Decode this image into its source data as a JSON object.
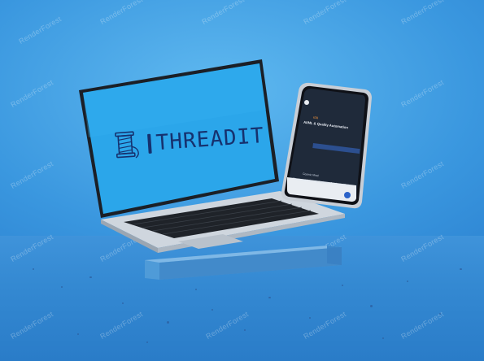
{
  "brand": {
    "name": "THREADIT"
  },
  "watermark": {
    "text": "RenderForest"
  },
  "phone_screen": {
    "feed_tag": "r/AI",
    "post_title": "AI/ML & Quality Automation",
    "second_author": "Cosmic Mind",
    "second_text": "Recommendations for beginner: Get Started Today"
  },
  "colors": {
    "background": "#3a97df",
    "screen": "#2aa2e8",
    "brand": "#16316e",
    "phone_ui": "#1f2a3a"
  }
}
